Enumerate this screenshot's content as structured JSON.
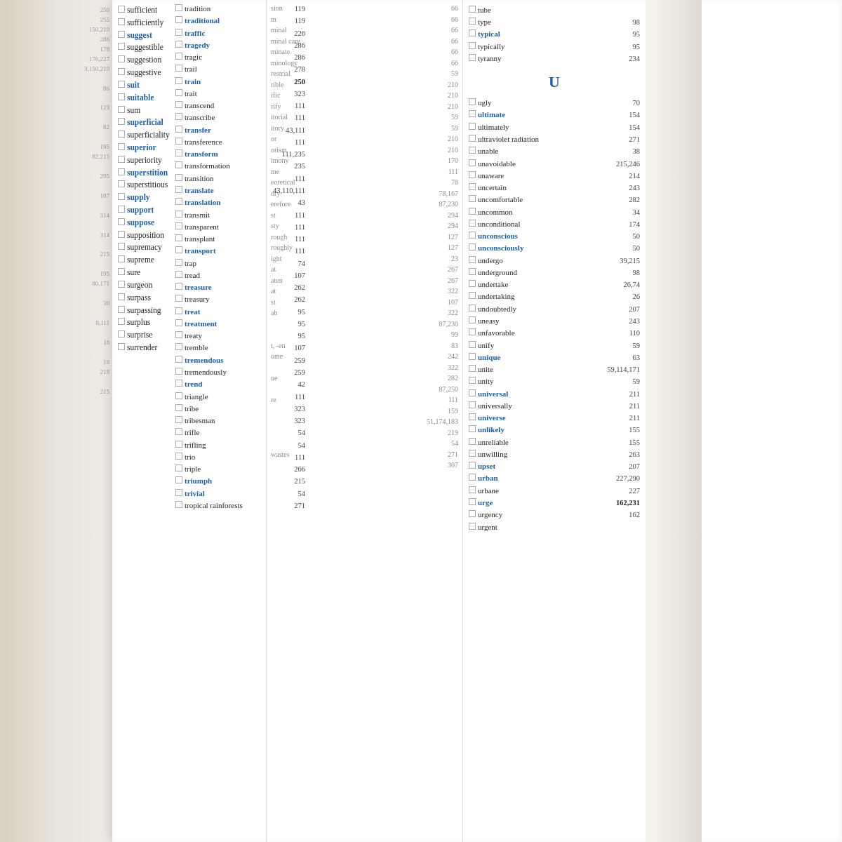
{
  "page": {
    "background": "#c8a87a"
  },
  "left_column": {
    "numbers_top": [
      "250",
      "255",
      "150,210",
      "286",
      "178",
      "176,227",
      "3,150,210",
      "86",
      "123",
      "82",
      "195",
      "82,215",
      "295",
      "107",
      "314",
      "314",
      "215",
      "195",
      "80,171",
      "30",
      "8,111",
      "18",
      "18",
      "218",
      "215"
    ],
    "words": [
      {
        "word": "sufficient",
        "blue": false,
        "num": ""
      },
      {
        "word": "sufficiently",
        "blue": false,
        "num": ""
      },
      {
        "word": "suggest",
        "blue": true,
        "num": ""
      },
      {
        "word": "suggestible",
        "blue": false,
        "num": ""
      },
      {
        "word": "suggestion",
        "blue": false,
        "num": ""
      },
      {
        "word": "suggestive",
        "blue": false,
        "num": ""
      },
      {
        "word": "suit",
        "blue": true,
        "num": ""
      },
      {
        "word": "suitable",
        "blue": true,
        "num": ""
      },
      {
        "word": "sum",
        "blue": false,
        "num": ""
      },
      {
        "word": "superficial",
        "blue": true,
        "num": ""
      },
      {
        "word": "superficiality",
        "blue": false,
        "num": ""
      },
      {
        "word": "superior",
        "blue": true,
        "num": ""
      },
      {
        "word": "superiority",
        "blue": false,
        "num": ""
      },
      {
        "word": "superstition",
        "blue": true,
        "num": ""
      },
      {
        "word": "superstitious",
        "blue": false,
        "num": ""
      },
      {
        "word": "supply",
        "blue": true,
        "num": ""
      },
      {
        "word": "support",
        "blue": true,
        "num": ""
      },
      {
        "word": "suppose",
        "blue": true,
        "num": ""
      },
      {
        "word": "supposition",
        "blue": false,
        "num": ""
      },
      {
        "word": "supremacy",
        "blue": false,
        "num": ""
      },
      {
        "word": "supreme",
        "blue": false,
        "num": ""
      },
      {
        "word": "sure",
        "blue": false,
        "num": ""
      },
      {
        "word": "surgeon",
        "blue": false,
        "num": ""
      },
      {
        "word": "surpass",
        "blue": false,
        "num": ""
      },
      {
        "word": "surpassing",
        "blue": false,
        "num": ""
      },
      {
        "word": "surplus",
        "blue": false,
        "num": ""
      },
      {
        "word": "surprise",
        "blue": false,
        "num": ""
      },
      {
        "word": "surrender",
        "blue": false,
        "num": ""
      }
    ]
  },
  "middle_column": {
    "entries_top": [
      {
        "text": "sion",
        "num": "66"
      },
      {
        "text": "m",
        "num": "66"
      },
      {
        "text": "minal",
        "num": "66"
      },
      {
        "text": "minal care",
        "num": "66"
      },
      {
        "text": "minate",
        "num": "66"
      },
      {
        "text": "minology",
        "num": "66"
      },
      {
        "text": "restrial",
        "num": "59"
      },
      {
        "text": "rible",
        "num": "210"
      },
      {
        "text": "ific",
        "num": "210"
      },
      {
        "text": "rify",
        "num": "210"
      },
      {
        "text": "itorial",
        "num": "59"
      },
      {
        "text": "itory",
        "num": "59"
      },
      {
        "text": "or",
        "num": "210"
      },
      {
        "text": "orism",
        "num": "210"
      },
      {
        "text": "imony",
        "num": "170"
      },
      {
        "text": "me",
        "num": "111"
      },
      {
        "text": "eoretical",
        "num": "78"
      },
      {
        "text": "ory",
        "num": "78,167"
      },
      {
        "text": "erefore",
        "num": "87,230"
      },
      {
        "text": "st",
        "num": "294"
      },
      {
        "text": "sty",
        "num": "294"
      },
      {
        "text": "rough",
        "num": "127"
      },
      {
        "text": "roughly",
        "num": "127"
      },
      {
        "text": "ight",
        "num": "23"
      },
      {
        "text": "at",
        "num": "267"
      },
      {
        "text": "aten",
        "num": "267"
      },
      {
        "text": "at",
        "num": "322"
      },
      {
        "text": "st",
        "num": "107"
      },
      {
        "text": "ab",
        "num": "322"
      },
      {
        "text": "",
        "num": "87,230"
      },
      {
        "text": "",
        "num": "99"
      },
      {
        "text": "t, -en",
        "num": "83"
      },
      {
        "text": "ome",
        "num": "242"
      },
      {
        "text": "",
        "num": "322"
      },
      {
        "text": "ue",
        "num": "282"
      },
      {
        "text": "",
        "num": "87,250"
      },
      {
        "text": "re",
        "num": "111"
      },
      {
        "text": "",
        "num": "159"
      },
      {
        "text": "",
        "num": "51,174,183"
      },
      {
        "text": "",
        "num": "219"
      },
      {
        "text": "",
        "num": "54"
      },
      {
        "text": "wastes",
        "num": "271"
      },
      {
        "text": "",
        "num": "307"
      }
    ],
    "words": [
      {
        "word": "tradition",
        "blue": false,
        "num": "119"
      },
      {
        "word": "traditional",
        "blue": true,
        "num": "119"
      },
      {
        "word": "traffic",
        "blue": true,
        "num": "226"
      },
      {
        "word": "tragedy",
        "blue": true,
        "num": "286"
      },
      {
        "word": "tragic",
        "blue": false,
        "num": "286"
      },
      {
        "word": "trail",
        "blue": false,
        "num": "278"
      },
      {
        "word": "train",
        "blue": true,
        "num": "250"
      },
      {
        "word": "trait",
        "blue": false,
        "num": "323"
      },
      {
        "word": "transcend",
        "blue": false,
        "num": "111"
      },
      {
        "word": "transcribe",
        "blue": false,
        "num": "111"
      },
      {
        "word": "transfer",
        "blue": true,
        "num": "43,111"
      },
      {
        "word": "transference",
        "blue": false,
        "num": "111"
      },
      {
        "word": "transform",
        "blue": true,
        "num": "111,235"
      },
      {
        "word": "transformation",
        "blue": false,
        "num": "235"
      },
      {
        "word": "transition",
        "blue": false,
        "num": "111"
      },
      {
        "word": "translate",
        "blue": true,
        "num": "43,110,111"
      },
      {
        "word": "translation",
        "blue": true,
        "num": "43"
      },
      {
        "word": "transmit",
        "blue": false,
        "num": "111"
      },
      {
        "word": "transparent",
        "blue": false,
        "num": "111"
      },
      {
        "word": "transplant",
        "blue": false,
        "num": "111"
      },
      {
        "word": "transport",
        "blue": true,
        "num": "111"
      },
      {
        "word": "trap",
        "blue": false,
        "num": "74"
      },
      {
        "word": "tread",
        "blue": false,
        "num": "107"
      },
      {
        "word": "treasure",
        "blue": true,
        "num": "262"
      },
      {
        "word": "treasury",
        "blue": false,
        "num": "262"
      },
      {
        "word": "treat",
        "blue": true,
        "num": "95"
      },
      {
        "word": "treatment",
        "blue": true,
        "num": "95"
      },
      {
        "word": "treaty",
        "blue": false,
        "num": "95"
      },
      {
        "word": "tremble",
        "blue": false,
        "num": "107"
      },
      {
        "word": "tremendous",
        "blue": true,
        "num": "259"
      },
      {
        "word": "tremendously",
        "blue": false,
        "num": "259"
      },
      {
        "word": "trend",
        "blue": true,
        "num": "42"
      },
      {
        "word": "triangle",
        "blue": false,
        "num": "111"
      },
      {
        "word": "tribe",
        "blue": false,
        "num": "323"
      },
      {
        "word": "tribesman",
        "blue": false,
        "num": "323"
      },
      {
        "word": "trifle",
        "blue": false,
        "num": "54"
      },
      {
        "word": "trifling",
        "blue": false,
        "num": "54"
      },
      {
        "word": "trio",
        "blue": false,
        "num": "111"
      },
      {
        "word": "triple",
        "blue": false,
        "num": "266"
      },
      {
        "word": "triumph",
        "blue": true,
        "num": "215"
      },
      {
        "word": "trivial",
        "blue": true,
        "num": "54"
      },
      {
        "word": "tropical rainforests",
        "blue": false,
        "num": "271"
      }
    ]
  },
  "right_column": {
    "section_header": "U",
    "top_words": [
      {
        "word": "tube",
        "blue": false,
        "num": ""
      },
      {
        "word": "type",
        "blue": false,
        "num": "98"
      },
      {
        "word": "typical",
        "blue": true,
        "num": "95"
      },
      {
        "word": "typically",
        "blue": false,
        "num": "95"
      },
      {
        "word": "tyranny",
        "blue": false,
        "num": "234"
      }
    ],
    "words": [
      {
        "word": "ugly",
        "blue": false,
        "num": "70"
      },
      {
        "word": "ultimate",
        "blue": true,
        "num": "154"
      },
      {
        "word": "ultimately",
        "blue": false,
        "num": "154"
      },
      {
        "word": "ultraviolet radiation",
        "blue": false,
        "num": "271"
      },
      {
        "word": "unable",
        "blue": false,
        "num": "38"
      },
      {
        "word": "unavoidable",
        "blue": false,
        "num": "215,246"
      },
      {
        "word": "unaware",
        "blue": false,
        "num": "214"
      },
      {
        "word": "uncertain",
        "blue": false,
        "num": "243"
      },
      {
        "word": "uncomfortable",
        "blue": false,
        "num": "282"
      },
      {
        "word": "uncommon",
        "blue": false,
        "num": "34"
      },
      {
        "word": "unconditional",
        "blue": false,
        "num": "174"
      },
      {
        "word": "unconscious",
        "blue": true,
        "num": "50"
      },
      {
        "word": "unconsciously",
        "blue": true,
        "num": "50"
      },
      {
        "word": "undergo",
        "blue": false,
        "num": "39,215"
      },
      {
        "word": "underground",
        "blue": false,
        "num": "98"
      },
      {
        "word": "undertake",
        "blue": false,
        "num": "26,74"
      },
      {
        "word": "undertaking",
        "blue": false,
        "num": "26"
      },
      {
        "word": "undoubtedly",
        "blue": false,
        "num": "207"
      },
      {
        "word": "uneasy",
        "blue": false,
        "num": "243"
      },
      {
        "word": "unfavorable",
        "blue": false,
        "num": "110"
      },
      {
        "word": "unify",
        "blue": false,
        "num": "59"
      },
      {
        "word": "unique",
        "blue": true,
        "num": "63"
      },
      {
        "word": "unite",
        "blue": false,
        "num": "59,114,171"
      },
      {
        "word": "unity",
        "blue": false,
        "num": "59"
      },
      {
        "word": "universal",
        "blue": true,
        "num": "211"
      },
      {
        "word": "universally",
        "blue": false,
        "num": "211"
      },
      {
        "word": "universe",
        "blue": true,
        "num": "211"
      },
      {
        "word": "unlikely",
        "blue": true,
        "num": "155"
      },
      {
        "word": "unreliable",
        "blue": false,
        "num": "155"
      },
      {
        "word": "unwilling",
        "blue": false,
        "num": "263"
      },
      {
        "word": "upset",
        "blue": true,
        "num": "207"
      },
      {
        "word": "urban",
        "blue": true,
        "num": "227,290"
      },
      {
        "word": "urbane",
        "blue": false,
        "num": "227"
      },
      {
        "word": "urge",
        "blue": true,
        "num": "162,231"
      },
      {
        "word": "urgency",
        "blue": false,
        "num": "162"
      },
      {
        "word": "urgent",
        "blue": false,
        "num": ""
      }
    ]
  }
}
